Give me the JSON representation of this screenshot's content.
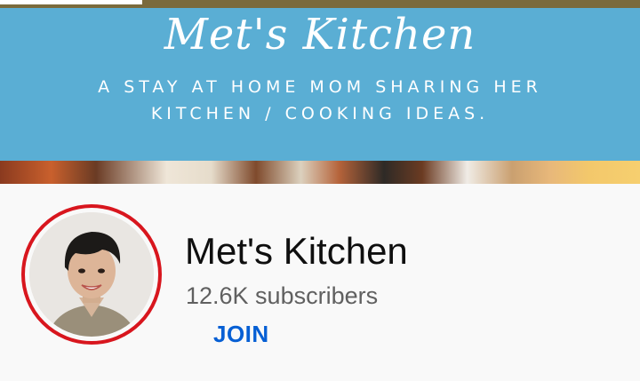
{
  "banner": {
    "title": "Met's Kitchen",
    "tagline_line1": "A STAY AT HOME MOM SHARING HER",
    "tagline_line2": "KITCHEN / COOKING IDEAS."
  },
  "channel": {
    "name": "Met's Kitchen",
    "subscribers": "12.6K subscribers",
    "join_label": "JOIN",
    "avatar_ring_color": "#d8161e"
  },
  "colors": {
    "banner_bg": "#5aaed4",
    "join": "#065fd4",
    "accent_bar": "#7a6a3c"
  }
}
